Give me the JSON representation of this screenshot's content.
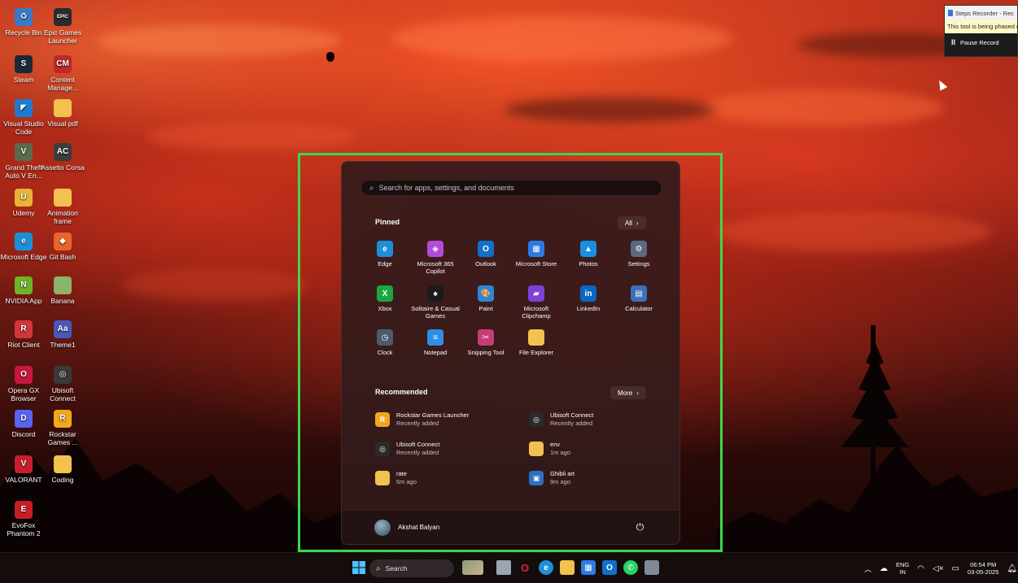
{
  "desktop": {
    "icons": [
      {
        "label": "Recycle Bin",
        "glyph": "♻",
        "color": "#3a78c9"
      },
      {
        "label": "Epic Games Launcher",
        "glyph": "EPIC",
        "color": "#2b2b2b"
      },
      {
        "label": "Steam",
        "glyph": "S",
        "color": "#1b2838"
      },
      {
        "label": "Content Manage...",
        "glyph": "CM",
        "color": "#c0282a"
      },
      {
        "label": "Visual Studio Code",
        "glyph": "◤",
        "color": "#1f7ad1"
      },
      {
        "label": "Visual pdf",
        "glyph": "",
        "color": "#f2c14e"
      },
      {
        "label": "Grand Theft Auto V En...",
        "glyph": "V",
        "color": "#5a6b4a"
      },
      {
        "label": "Assetto Corsa",
        "glyph": "AC",
        "color": "#3d3d3d"
      },
      {
        "label": "Udemy",
        "glyph": "U",
        "color": "#e8b436"
      },
      {
        "label": "Animation frame",
        "glyph": "",
        "color": "#f2c14e"
      },
      {
        "label": "Microsoft Edge",
        "glyph": "e",
        "color": "#1d8fd8"
      },
      {
        "label": "Git Bash",
        "glyph": "◆",
        "color": "#e8642c"
      },
      {
        "label": "NVIDIA App",
        "glyph": "N",
        "color": "#6fb32a"
      },
      {
        "label": "Banana",
        "glyph": "",
        "color": "#8bb36a"
      },
      {
        "label": "Riot Client",
        "glyph": "R",
        "color": "#d13639"
      },
      {
        "label": "Theme1",
        "glyph": "Aa",
        "color": "#4a58b8"
      },
      {
        "label": "Opera GX Browser",
        "glyph": "O",
        "color": "#c7183c"
      },
      {
        "label": "Ubisoft Connect",
        "glyph": "◎",
        "color": "#3a3a3a"
      },
      {
        "label": "Discord",
        "glyph": "D",
        "color": "#5865f2"
      },
      {
        "label": "Rockstar Games ...",
        "glyph": "R",
        "color": "#f0a81c"
      },
      {
        "label": "VALORANT",
        "glyph": "V",
        "color": "#c8202b"
      },
      {
        "label": "Coding",
        "glyph": "",
        "color": "#f2c14e"
      },
      {
        "label": "EvoFox Phantom 2",
        "glyph": "E",
        "color": "#c81d25"
      }
    ]
  },
  "steps_recorder": {
    "title": "Steps Recorder - Rec",
    "notice": "This tool is being phased o",
    "pause_label": "Pause Record"
  },
  "start_menu": {
    "search_placeholder": "Search for apps, settings, and documents",
    "pinned_title": "Pinned",
    "all_label": "All",
    "pinned": [
      {
        "label": "Edge",
        "glyph": "e",
        "color": "#1d8fd8"
      },
      {
        "label": "Microsoft 365 Copilot",
        "glyph": "◈",
        "color": "#b54ad6"
      },
      {
        "label": "Outlook",
        "glyph": "O",
        "color": "#1170c9"
      },
      {
        "label": "Microsoft Store",
        "glyph": "▦",
        "color": "#2c7be5"
      },
      {
        "label": "Photos",
        "glyph": "▲",
        "color": "#1a8fe0"
      },
      {
        "label": "Settings",
        "glyph": "⚙",
        "color": "#5a6a80"
      },
      {
        "label": "Xbox",
        "glyph": "X",
        "color": "#1ca641"
      },
      {
        "label": "Solitaire & Casual Games",
        "glyph": "♠",
        "color": "#1b1b1b"
      },
      {
        "label": "Paint",
        "glyph": "🎨",
        "color": "#2a86d8"
      },
      {
        "label": "Microsoft Clipchamp",
        "glyph": "▰",
        "color": "#7d42d6"
      },
      {
        "label": "LinkedIn",
        "glyph": "in",
        "color": "#0a66c2"
      },
      {
        "label": "Calculator",
        "glyph": "▤",
        "color": "#3b6fb8"
      },
      {
        "label": "Clock",
        "glyph": "◷",
        "color": "#4c5b6e"
      },
      {
        "label": "Notepad",
        "glyph": "≡",
        "color": "#2f8ee6"
      },
      {
        "label": "Snipping Tool",
        "glyph": "✂",
        "color": "#c83c7a"
      },
      {
        "label": "File Explorer",
        "glyph": "",
        "color": "#f2c14e"
      }
    ],
    "recommended_title": "Recommended",
    "more_label": "More",
    "recommended": [
      {
        "name": "Rockstar Games Launcher",
        "sub": "Recently added",
        "glyph": "R",
        "color": "#f0a81c"
      },
      {
        "name": "Ubisoft Connect",
        "sub": "Recently added",
        "glyph": "◎",
        "color": "#2b2b2b"
      },
      {
        "name": "Ubisoft Connect",
        "sub": "Recently added",
        "glyph": "◎",
        "color": "#2b2b2b"
      },
      {
        "name": "env",
        "sub": "1m ago",
        "glyph": "",
        "color": "#f2c14e"
      },
      {
        "name": "rate",
        "sub": "6m ago",
        "glyph": "",
        "color": "#f2c14e"
      },
      {
        "name": "Ghibli art",
        "sub": "9m ago",
        "glyph": "▣",
        "color": "#2d6fc4"
      }
    ],
    "user_name": "Akshat Balyan",
    "power_icon": "⏻"
  },
  "taskbar": {
    "search_label": "Search",
    "tray": {
      "lang_top": "ENG",
      "lang_bottom": "IN",
      "time": "06:54 PM",
      "date": "03-05-2025"
    }
  },
  "colors": {
    "highlight": "#3fd64a",
    "menu_bg": "#341b1b",
    "taskbar_bg": "#160c0c"
  }
}
